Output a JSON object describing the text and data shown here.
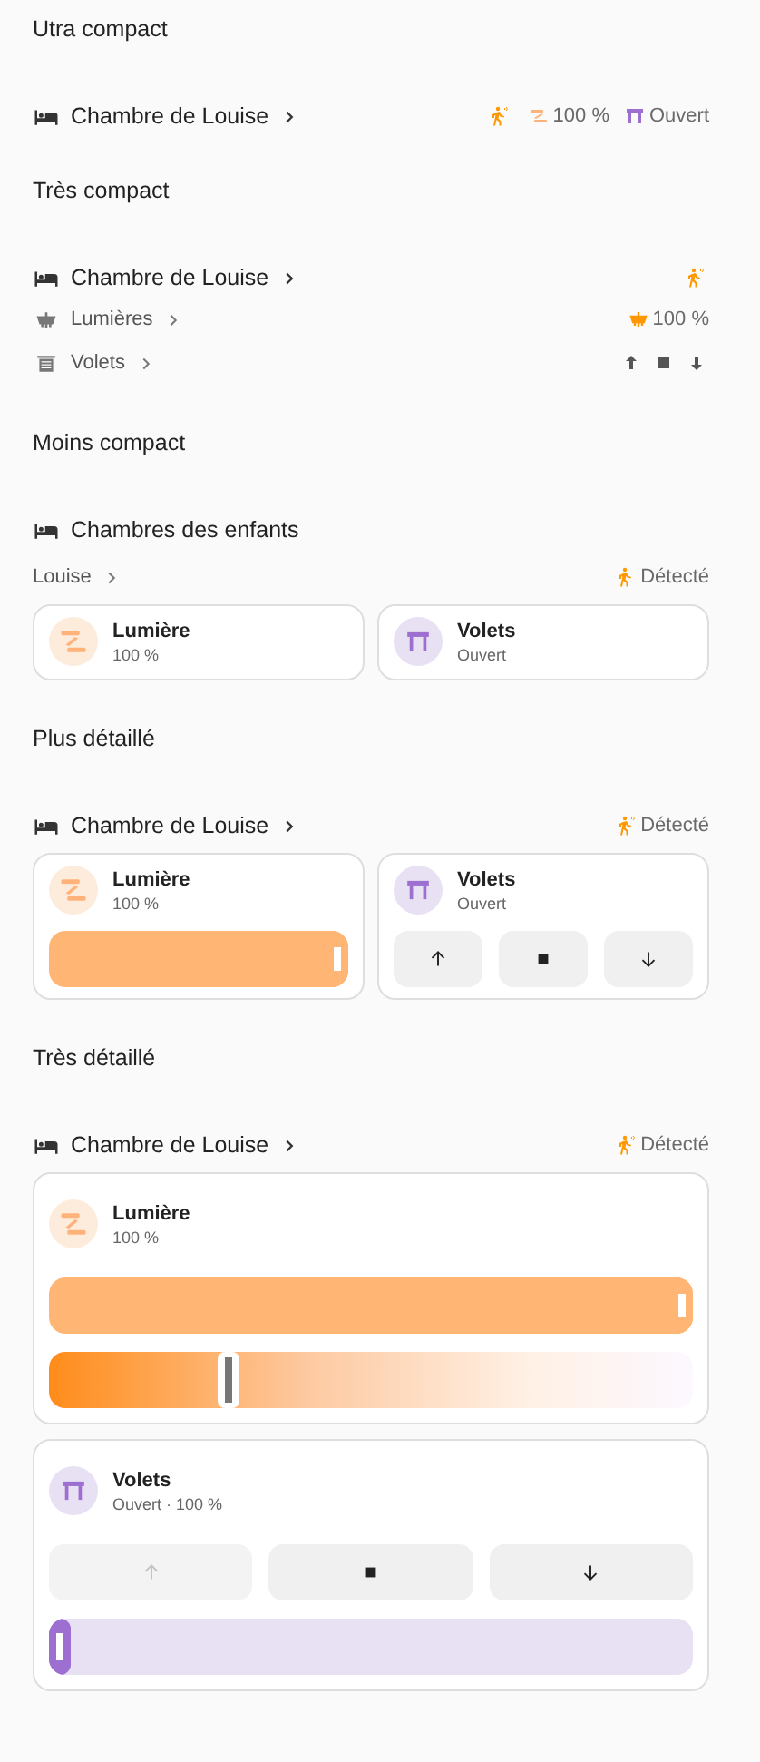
{
  "sections": [
    {
      "title": "Utra compact",
      "kind": "ultra",
      "header": {
        "name": "Chambre de Louise",
        "link": true,
        "badges": [
          {
            "kind": "motion"
          },
          {
            "kind": "light",
            "text": "100 %"
          },
          {
            "kind": "cover",
            "text": "Ouvert"
          }
        ]
      }
    },
    {
      "title": "Très compact",
      "kind": "compact",
      "header": {
        "name": "Chambre de Louise",
        "link": true,
        "badges": [
          {
            "kind": "motion"
          }
        ]
      },
      "rows": [
        {
          "kind": "light",
          "name": "Lumières",
          "value": "100 %"
        },
        {
          "kind": "cover",
          "name": "Volets",
          "buttons": [
            {
              "kind": "up",
              "disabled": false
            },
            {
              "kind": "stop",
              "disabled": false
            },
            {
              "kind": "down",
              "disabled": false
            }
          ]
        }
      ]
    },
    {
      "title": "Moins compact",
      "kind": "tiles",
      "header": {
        "name": "Chambres des enfants",
        "link": false
      },
      "subheader": {
        "name": "Louise",
        "badge": "Détecté"
      },
      "tiles": [
        {
          "kind": "light",
          "name": "Lumière",
          "state": "100 %"
        },
        {
          "kind": "cover",
          "name": "Volets",
          "state": "Ouvert"
        }
      ]
    },
    {
      "title": "Plus détaillé",
      "kind": "tiles",
      "header": {
        "name": "Chambre de Louise",
        "link": true,
        "badges": [
          {
            "kind": "motion",
            "text": "Détecté"
          }
        ]
      },
      "tiles": [
        {
          "kind": "light",
          "name": "Lumière",
          "state": "100 %",
          "sliders": [
            {
              "kind": "brightness",
              "level": 1
            }
          ]
        },
        {
          "kind": "cover",
          "name": "Volets",
          "state": "Ouvert",
          "buttons": [
            {
              "kind": "up",
              "disabled": false
            },
            {
              "kind": "stop",
              "disabled": false
            },
            {
              "kind": "down",
              "disabled": false
            }
          ]
        }
      ]
    },
    {
      "title": "Très détaillé",
      "kind": "cards",
      "header": {
        "name": "Chambre de Louise",
        "link": true,
        "badges": [
          {
            "kind": "motion",
            "text": "Détecté"
          }
        ]
      },
      "tiles": [
        {
          "kind": "light",
          "name": "Lumière",
          "state": "100 %",
          "sliders": [
            {
              "kind": "brightness",
              "level": 1
            },
            {
              "kind": "temperature",
              "level": 0.27
            }
          ]
        },
        {
          "kind": "cover",
          "name": "Volets",
          "state": "Ouvert · 100 %",
          "buttons": [
            {
              "kind": "up",
              "disabled": true
            },
            {
              "kind": "stop",
              "disabled": false
            },
            {
              "kind": "down",
              "disabled": false
            }
          ],
          "sliders": [
            {
              "kind": "position",
              "level": 0
            }
          ]
        }
      ]
    }
  ]
}
